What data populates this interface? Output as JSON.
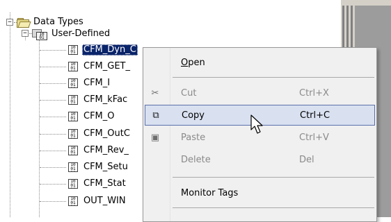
{
  "tree": {
    "root": {
      "label": "Data Types",
      "expander": "−"
    },
    "child": {
      "label": "User-Defined",
      "expander": "−"
    },
    "items": [
      "CFM_Dyn_C",
      "CFM_GET_",
      "CFM_I",
      "CFM_kFac",
      "CFM_O",
      "CFM_OutC",
      "CFM_Rev_",
      "CFM_Setu",
      "CFM_Stat",
      "OUT_WIN"
    ]
  },
  "context_menu": {
    "open": {
      "label": "Open",
      "accel": "O"
    },
    "cut": {
      "label": "Cut",
      "shortcut": "Ctrl+X"
    },
    "copy": {
      "label": "Copy",
      "shortcut": "Ctrl+C"
    },
    "paste": {
      "label": "Paste",
      "shortcut": "Ctrl+V"
    },
    "delete": {
      "label": "Delete",
      "shortcut": "Del"
    },
    "monitor_tags": {
      "label": "Monitor Tags"
    }
  },
  "colors": {
    "selection": "#0a246a",
    "menu_hover": "#d9e1f1",
    "menu_hover_border": "#5a6fa8"
  }
}
